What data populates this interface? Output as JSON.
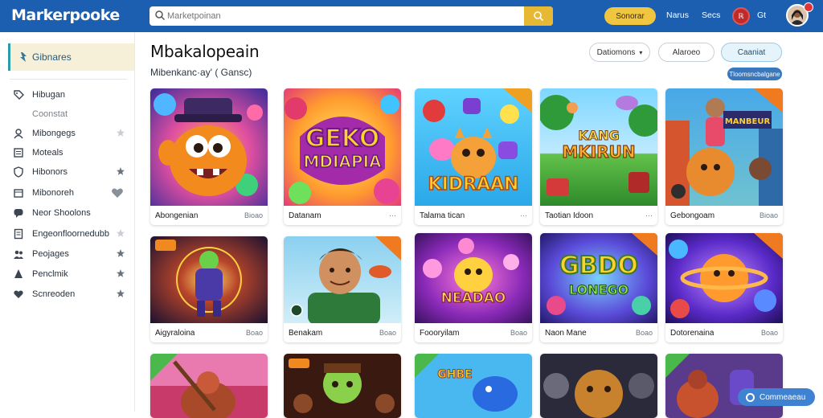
{
  "header": {
    "logo": "Markerpooke",
    "search_placeholder": "Marketpoinan",
    "signin_label": "Sonorar",
    "links": [
      "Narus",
      "Secs"
    ],
    "notif_label": "ℝ",
    "lang_label": "Gt"
  },
  "sidebar": {
    "active_label": "Gibnares",
    "items": [
      {
        "label": "Hibugan",
        "icon": "tag-icon",
        "trail": ""
      },
      {
        "label": "Coonstat",
        "icon": "spacer",
        "trail": "",
        "muted": true
      },
      {
        "label": "Mibongegs",
        "icon": "user-icon",
        "trail": "star"
      },
      {
        "label": "Moteals",
        "icon": "list-icon",
        "trail": ""
      },
      {
        "label": "Hibonors",
        "icon": "shield-icon",
        "trail": "star"
      },
      {
        "label": "Mibonoreh",
        "icon": "box-icon",
        "trail": "heart"
      },
      {
        "label": "Neor Shoolons",
        "icon": "chat-icon",
        "trail": ""
      },
      {
        "label": "Engeonfloornedubb",
        "icon": "doc-icon",
        "trail": "star"
      },
      {
        "label": "Peojages",
        "icon": "people-icon",
        "trail": "star"
      },
      {
        "label": "Penclmik",
        "icon": "person-icon",
        "trail": "star"
      },
      {
        "label": "Scnreoden",
        "icon": "heart-icon",
        "trail": "star"
      }
    ]
  },
  "main": {
    "title": "Mbakalopeain",
    "subtitle": "Mibenkanc·ay' ( Gansc)",
    "filters": [
      "Datiomons",
      "Alaroeo",
      "Caaniat"
    ],
    "tag": "Tloomsncbalgane",
    "cards": [
      {
        "name": "Abongenian",
        "meta": "Bioao",
        "art": "Monster"
      },
      {
        "name": "Datanam",
        "meta": "···",
        "art": "Gekotext"
      },
      {
        "name": "Talama tican",
        "meta": "···",
        "art": "Kibraan"
      },
      {
        "name": "Taotian Idoon",
        "meta": "···",
        "art": "Mkirun"
      },
      {
        "name": "Gebongoam",
        "meta": "Bioao",
        "art": "Hero"
      },
      {
        "name": "Aigyraloina",
        "meta": "Boao",
        "art": "Glow"
      },
      {
        "name": "Benakam",
        "meta": "Boao",
        "art": "Farmer"
      },
      {
        "name": "Foooryilam",
        "meta": "Boao",
        "art": "Neadao"
      },
      {
        "name": "Naon Mane",
        "meta": "Boao",
        "art": "Gbdo"
      },
      {
        "name": "Dotorenaina",
        "meta": "Boao",
        "art": "Planet"
      },
      {
        "name": "",
        "meta": "",
        "art": "Bear"
      },
      {
        "name": "",
        "meta": "",
        "art": "Hulk"
      },
      {
        "name": "",
        "meta": "",
        "art": "Fish"
      },
      {
        "name": "",
        "meta": "",
        "art": "Bears"
      },
      {
        "name": "",
        "meta": "",
        "art": "Mage"
      }
    ]
  },
  "contact_label": "Commeaeau",
  "colors": {
    "header": "#1c5fb1",
    "accent": "#f0c640",
    "active": "#f7f0d9"
  }
}
